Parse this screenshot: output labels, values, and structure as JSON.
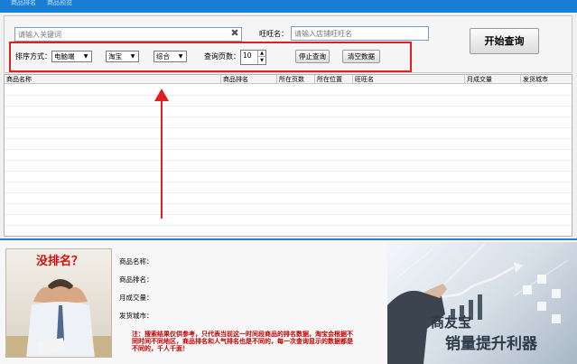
{
  "topbar": {
    "tabs": [
      "商品排名",
      "商品预览"
    ]
  },
  "search": {
    "keyword_placeholder": "请输入关键词",
    "wangwang_label": "旺旺名：",
    "wangwang_placeholder": "请输入店铺旺旺名",
    "start_button": "开始查询"
  },
  "options": {
    "sort_label": "排序方式：",
    "device_value": "电脑端",
    "platform_value": "淘宝",
    "order_value": "综合",
    "pages_label": "查询页数：",
    "pages_value": "10",
    "stop_button": "停止查询",
    "clear_button": "清空数据"
  },
  "table": {
    "columns": [
      "商品名称",
      "商品排名",
      "所在页数",
      "所在位置",
      "旺旺名",
      "月成交量",
      "发货城市"
    ]
  },
  "detail": {
    "no_rank_text": "没排名？",
    "name_label": "商品名称：",
    "rank_label": "商品排名：",
    "monthly_label": "月成交量：",
    "city_label": "发货城市：",
    "note": "注：搜索结果仅供参考，只代表当前这一时间段商品的排名数据，淘宝会根据不同时间不同地区，商品排名和人气排名也是不同的，每一次查询显示的数据都是不同的，千人千面！"
  },
  "ad": {
    "title": "商友宝",
    "subtitle": "销量提升利器"
  },
  "colors": {
    "accent": "#1a7fd4",
    "highlight": "#e02020",
    "note": "#c00000"
  }
}
